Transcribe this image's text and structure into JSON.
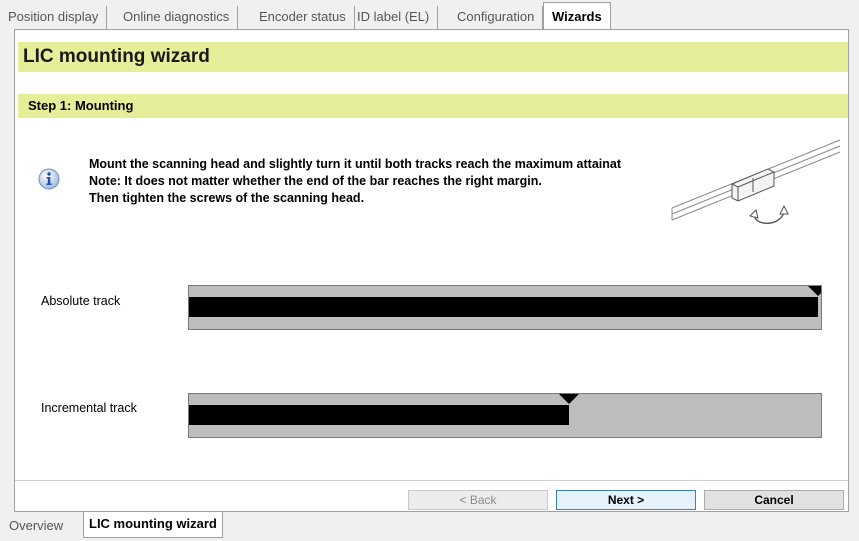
{
  "top_tabs": [
    {
      "label": "Position display",
      "active": false
    },
    {
      "label": "Online diagnostics",
      "active": false
    },
    {
      "label": "Encoder status",
      "active": false
    },
    {
      "label": "ID label (EL)",
      "active": false
    },
    {
      "label": "Configuration",
      "active": false
    },
    {
      "label": "Wizards",
      "active": true
    }
  ],
  "wizard": {
    "title": "LIC mounting wizard",
    "step_title": "Step 1: Mounting",
    "instructions": [
      "Mount the scanning head and slightly turn it until both tracks reach the maximum attainat",
      "Note: It does not matter whether the end of the bar reaches the right margin.",
      "Then tighten the screws of the scanning head."
    ],
    "icons": {
      "info": "info-icon",
      "illustration": "scanning-head-mount-illustration"
    }
  },
  "tracks": {
    "absolute": {
      "label": "Absolute track",
      "level_percent": 99.5,
      "marker_percent": 99.5
    },
    "incremental": {
      "label": "Incremental track",
      "level_percent": 60.2,
      "marker_percent": 60.2
    }
  },
  "buttons": {
    "back": "< Back",
    "next": "Next >",
    "cancel": "Cancel"
  },
  "bottom_tabs": [
    {
      "label": "Overview",
      "active": false
    },
    {
      "label": "LIC mounting wizard",
      "active": true
    }
  ],
  "colors": {
    "header_band": "#e6ee9a",
    "track_background": "#bdbdbd",
    "track_fill": "#000000"
  }
}
